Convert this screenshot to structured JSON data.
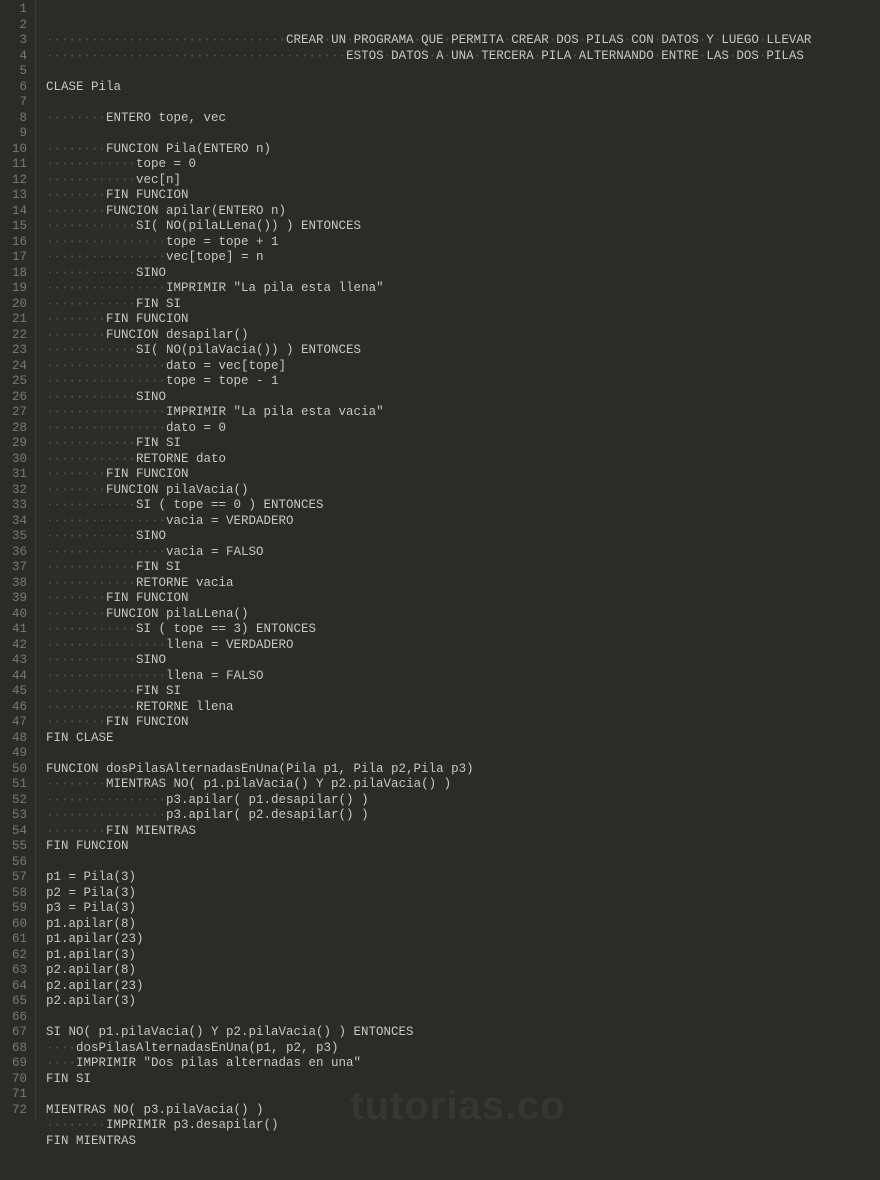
{
  "watermark": "tutorias.co",
  "lines": [
    {
      "n": 1,
      "indent": "                                ",
      "text": "CREAR UN PROGRAMA QUE PERMITA CREAR DOS PILAS CON DATOS Y LUEGO LLEVAR"
    },
    {
      "n": 2,
      "indent": "                                        ",
      "text": "ESTOS DATOS A UNA TERCERA PILA ALTERNANDO ENTRE LAS DOS PILAS"
    },
    {
      "n": 3,
      "indent": "",
      "text": ""
    },
    {
      "n": 4,
      "indent": "",
      "text": "CLASE Pila"
    },
    {
      "n": 5,
      "indent": "",
      "text": ""
    },
    {
      "n": 6,
      "indent": "        ",
      "text": "ENTERO tope, vec"
    },
    {
      "n": 7,
      "indent": "",
      "text": ""
    },
    {
      "n": 8,
      "indent": "        ",
      "text": "FUNCION Pila(ENTERO n)"
    },
    {
      "n": 9,
      "indent": "            ",
      "text": "tope = 0"
    },
    {
      "n": 10,
      "indent": "            ",
      "text": "vec[n]"
    },
    {
      "n": 11,
      "indent": "        ",
      "text": "FIN FUNCION"
    },
    {
      "n": 12,
      "indent": "        ",
      "text": "FUNCION apilar(ENTERO n)"
    },
    {
      "n": 13,
      "indent": "            ",
      "text": "SI( NO(pilaLLena()) ) ENTONCES"
    },
    {
      "n": 14,
      "indent": "                ",
      "text": "tope = tope + 1"
    },
    {
      "n": 15,
      "indent": "                ",
      "text": "vec[tope] = n"
    },
    {
      "n": 16,
      "indent": "            ",
      "text": "SINO"
    },
    {
      "n": 17,
      "indent": "                ",
      "text": "IMPRIMIR \"La pila esta llena\""
    },
    {
      "n": 18,
      "indent": "            ",
      "text": "FIN SI"
    },
    {
      "n": 19,
      "indent": "        ",
      "text": "FIN FUNCION"
    },
    {
      "n": 20,
      "indent": "        ",
      "text": "FUNCION desapilar()"
    },
    {
      "n": 21,
      "indent": "            ",
      "text": "SI( NO(pilaVacia()) ) ENTONCES"
    },
    {
      "n": 22,
      "indent": "                ",
      "text": "dato = vec[tope]"
    },
    {
      "n": 23,
      "indent": "                ",
      "text": "tope = tope - 1"
    },
    {
      "n": 24,
      "indent": "            ",
      "text": "SINO"
    },
    {
      "n": 25,
      "indent": "                ",
      "text": "IMPRIMIR \"La pila esta vacia\""
    },
    {
      "n": 26,
      "indent": "                ",
      "text": "dato = 0"
    },
    {
      "n": 27,
      "indent": "            ",
      "text": "FIN SI"
    },
    {
      "n": 28,
      "indent": "            ",
      "text": "RETORNE dato"
    },
    {
      "n": 29,
      "indent": "        ",
      "text": "FIN FUNCION"
    },
    {
      "n": 30,
      "indent": "        ",
      "text": "FUNCION pilaVacia()"
    },
    {
      "n": 31,
      "indent": "            ",
      "text": "SI ( tope == 0 ) ENTONCES"
    },
    {
      "n": 32,
      "indent": "                ",
      "text": "vacia = VERDADERO"
    },
    {
      "n": 33,
      "indent": "            ",
      "text": "SINO"
    },
    {
      "n": 34,
      "indent": "                ",
      "text": "vacia = FALSO"
    },
    {
      "n": 35,
      "indent": "            ",
      "text": "FIN SI"
    },
    {
      "n": 36,
      "indent": "            ",
      "text": "RETORNE vacia"
    },
    {
      "n": 37,
      "indent": "        ",
      "text": "FIN FUNCION"
    },
    {
      "n": 38,
      "indent": "        ",
      "text": "FUNCION pilaLLena()"
    },
    {
      "n": 39,
      "indent": "            ",
      "text": "SI ( tope == 3) ENTONCES"
    },
    {
      "n": 40,
      "indent": "                ",
      "text": "llena = VERDADERO"
    },
    {
      "n": 41,
      "indent": "            ",
      "text": "SINO"
    },
    {
      "n": 42,
      "indent": "                ",
      "text": "llena = FALSO"
    },
    {
      "n": 43,
      "indent": "            ",
      "text": "FIN SI"
    },
    {
      "n": 44,
      "indent": "            ",
      "text": "RETORNE llena"
    },
    {
      "n": 45,
      "indent": "        ",
      "text": "FIN FUNCION"
    },
    {
      "n": 46,
      "indent": "",
      "text": "FIN CLASE"
    },
    {
      "n": 47,
      "indent": "",
      "text": ""
    },
    {
      "n": 48,
      "indent": "",
      "text": "FUNCION dosPilasAlternadasEnUna(Pila p1, Pila p2,Pila p3)"
    },
    {
      "n": 49,
      "indent": "        ",
      "text": "MIENTRAS NO( p1.pilaVacia() Y p2.pilaVacia() )"
    },
    {
      "n": 50,
      "indent": "                ",
      "text": "p3.apilar( p1.desapilar() )"
    },
    {
      "n": 51,
      "indent": "                ",
      "text": "p3.apilar( p2.desapilar() )"
    },
    {
      "n": 52,
      "indent": "        ",
      "text": "FIN MIENTRAS"
    },
    {
      "n": 53,
      "indent": "",
      "text": "FIN FUNCION"
    },
    {
      "n": 54,
      "indent": "",
      "text": ""
    },
    {
      "n": 55,
      "indent": "",
      "text": "p1 = Pila(3)"
    },
    {
      "n": 56,
      "indent": "",
      "text": "p2 = Pila(3)"
    },
    {
      "n": 57,
      "indent": "",
      "text": "p3 = Pila(3)"
    },
    {
      "n": 58,
      "indent": "",
      "text": "p1.apilar(8)"
    },
    {
      "n": 59,
      "indent": "",
      "text": "p1.apilar(23)"
    },
    {
      "n": 60,
      "indent": "",
      "text": "p1.apilar(3)"
    },
    {
      "n": 61,
      "indent": "",
      "text": "p2.apilar(8)"
    },
    {
      "n": 62,
      "indent": "",
      "text": "p2.apilar(23)"
    },
    {
      "n": 63,
      "indent": "",
      "text": "p2.apilar(3)"
    },
    {
      "n": 64,
      "indent": "",
      "text": ""
    },
    {
      "n": 65,
      "indent": "",
      "text": "SI NO( p1.pilaVacia() Y p2.pilaVacia() ) ENTONCES"
    },
    {
      "n": 66,
      "indent": "    ",
      "text": "dosPilasAlternadasEnUna(p1, p2, p3)"
    },
    {
      "n": 67,
      "indent": "    ",
      "text": "IMPRIMIR \"Dos pilas alternadas en una\""
    },
    {
      "n": 68,
      "indent": "",
      "text": "FIN SI"
    },
    {
      "n": 69,
      "indent": "",
      "text": ""
    },
    {
      "n": 70,
      "indent": "",
      "text": "MIENTRAS NO( p3.pilaVacia() )"
    },
    {
      "n": 71,
      "indent": "        ",
      "text": "IMPRIMIR p3.desapilar()"
    },
    {
      "n": 72,
      "indent": "",
      "text": "FIN MIENTRAS"
    }
  ]
}
